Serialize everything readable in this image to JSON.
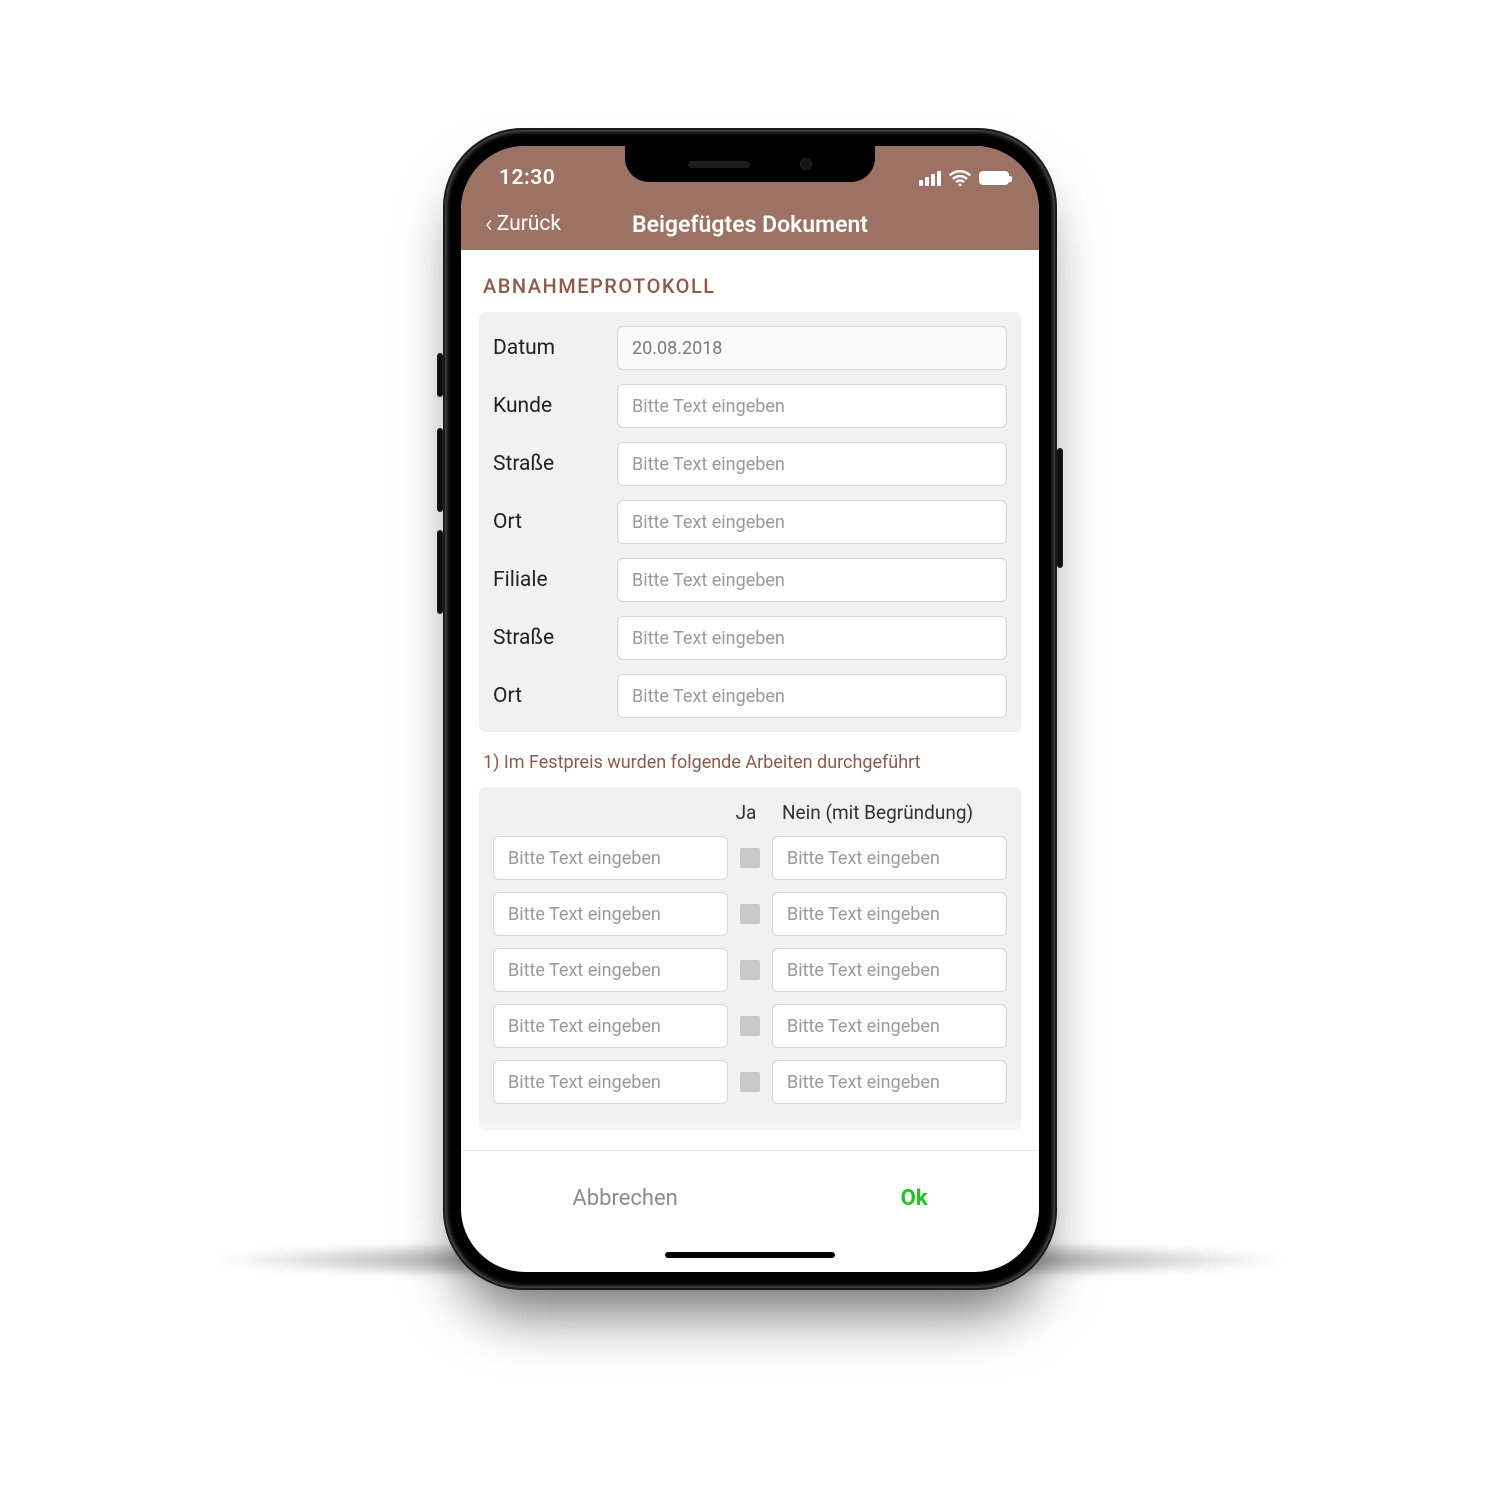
{
  "status": {
    "time": "12:30"
  },
  "nav": {
    "back": "Zurück",
    "title": "Beigefügtes Dokument"
  },
  "section": {
    "heading": "ABNAHMEPROTOKOLL"
  },
  "form": {
    "placeholder": "Bitte Text eingeben",
    "fields": [
      {
        "label": "Datum",
        "value": "20.08.2018"
      },
      {
        "label": "Kunde",
        "value": ""
      },
      {
        "label": "Straße",
        "value": ""
      },
      {
        "label": "Ort",
        "value": ""
      },
      {
        "label": "Filiale",
        "value": ""
      },
      {
        "label": "Straße",
        "value": ""
      },
      {
        "label": "Ort",
        "value": ""
      }
    ]
  },
  "question1": "1) Im Festpreis wurden folgende Arbeiten durchgeführt",
  "tableHeader": {
    "yes": "Ja",
    "no": "Nein (mit Begründung)"
  },
  "workRows": 5,
  "footer": {
    "cancel": "Abbrechen",
    "ok": "Ok"
  }
}
